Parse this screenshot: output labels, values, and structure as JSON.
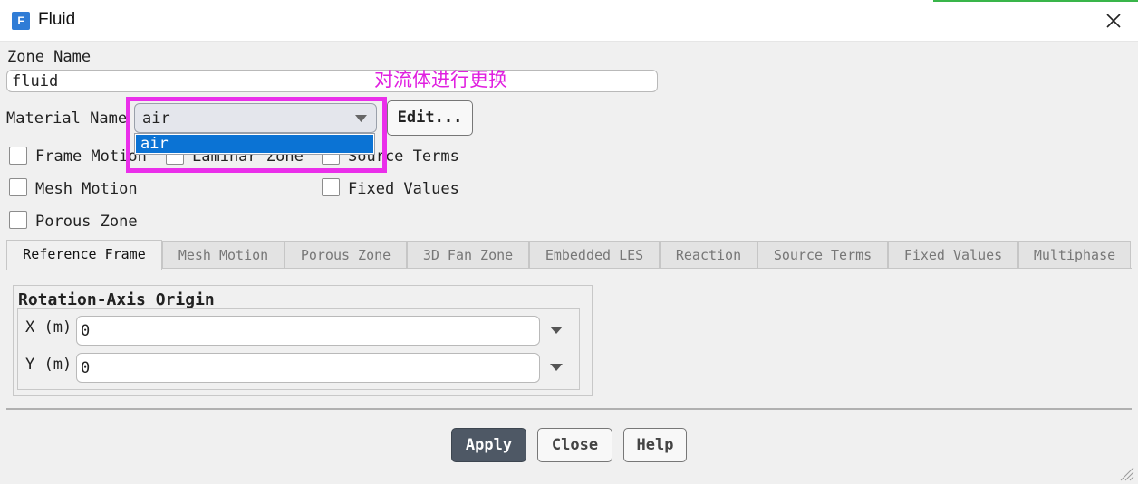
{
  "window": {
    "title": "Fluid",
    "icon_letter": "F"
  },
  "zone_name": {
    "label": "Zone Name",
    "value": "fluid"
  },
  "annotation": "对流体进行更换",
  "material": {
    "label": "Material Name",
    "selected": "air",
    "options": [
      "air"
    ],
    "edit_label": "Edit..."
  },
  "checkboxes": {
    "frame_motion": "Frame Motion",
    "laminar_zone": "Laminar Zone",
    "source_terms": "Source Terms",
    "mesh_motion": "Mesh Motion",
    "fixed_values": "Fixed Values",
    "porous_zone": "Porous Zone"
  },
  "tabs": [
    "Reference Frame",
    "Mesh Motion",
    "Porous Zone",
    "3D Fan Zone",
    "Embedded LES",
    "Reaction",
    "Source Terms",
    "Fixed Values",
    "Multiphase"
  ],
  "rotation_axis": {
    "title": "Rotation-Axis Origin",
    "x": {
      "label": "X (m)",
      "value": "0"
    },
    "y": {
      "label": "Y (m)",
      "value": "0"
    }
  },
  "buttons": {
    "apply": "Apply",
    "close": "Close",
    "help": "Help"
  },
  "colors": {
    "annotation": "#e020e0",
    "highlight_border": "#ea2fea",
    "selection": "#0b73d4",
    "apply_bg": "#4e5865"
  }
}
